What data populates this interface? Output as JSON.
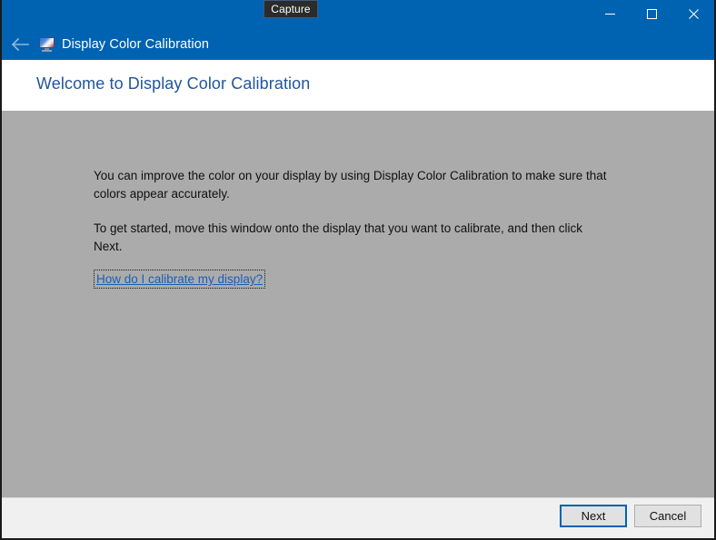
{
  "window": {
    "title": "Display Color Calibration",
    "app_icon": "display-monitor-icon",
    "accent_color": "#0063b1",
    "body_color": "#ababab",
    "header_color": "#ffffff",
    "footer_color": "#f0f0f0"
  },
  "tooltip": {
    "label": "Capture"
  },
  "titlebar": {
    "back_icon": "back-arrow-icon",
    "minimize_icon": "minimize-icon",
    "maximize_icon": "maximize-icon",
    "close_icon": "close-icon"
  },
  "page": {
    "heading": "Welcome to Display Color Calibration",
    "heading_color": "#22559c",
    "paragraph_1": "You can improve the color on your display by using Display Color Calibration to make sure that colors appear accurately.",
    "paragraph_2": "To get started, move this window onto the display that you want to calibrate, and then click Next.",
    "help_link": "How do I calibrate my display?",
    "help_link_color": "#1c5fb8"
  },
  "footer": {
    "next_label": "Next",
    "cancel_label": "Cancel"
  }
}
